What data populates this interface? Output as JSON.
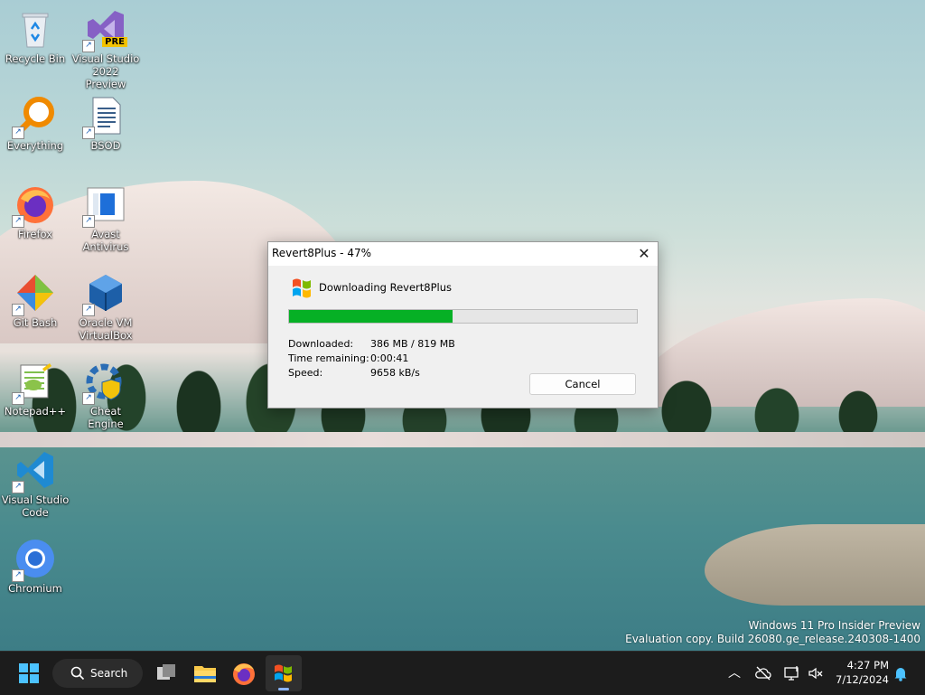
{
  "desktop": {
    "icons": [
      {
        "label": "Recycle Bin"
      },
      {
        "label": "Visual Studio 2022 Preview",
        "badge": "PRE"
      },
      {
        "label": "Everything"
      },
      {
        "label": "BSOD"
      },
      {
        "label": "Firefox"
      },
      {
        "label": "Avast Antivirus"
      },
      {
        "label": "Git Bash"
      },
      {
        "label": "Oracle VM VirtualBox"
      },
      {
        "label": "Notepad++"
      },
      {
        "label": "Cheat Engine"
      },
      {
        "label": "Visual Studio Code"
      },
      {
        "label": "Chromium"
      }
    ]
  },
  "dialog": {
    "title": "Revert8Plus - 47%",
    "heading": "Downloading Revert8Plus",
    "progress_percent": 47,
    "downloaded_label": "Downloaded:",
    "downloaded_value": "386 MB / 819 MB",
    "time_label": "Time remaining:",
    "time_value": "0:00:41",
    "speed_label": "Speed:",
    "speed_value": "9658 kB/s",
    "cancel_label": "Cancel",
    "progress_color": "#06b025"
  },
  "watermark": {
    "line1": "Windows 11 Pro Insider Preview",
    "line2": "Evaluation copy. Build 26080.ge_release.240308-1400"
  },
  "taskbar": {
    "search_label": "Search",
    "time": "4:27 PM",
    "date": "7/12/2024",
    "icons": [
      "start-icon",
      "search-icon",
      "task-view-icon",
      "file-explorer-icon",
      "firefox-icon",
      "revert8plus-icon"
    ],
    "tray": [
      "chevron-up-icon",
      "cloud-off-icon",
      "network-icon",
      "volume-muted-icon",
      "notification-bell-icon"
    ]
  }
}
